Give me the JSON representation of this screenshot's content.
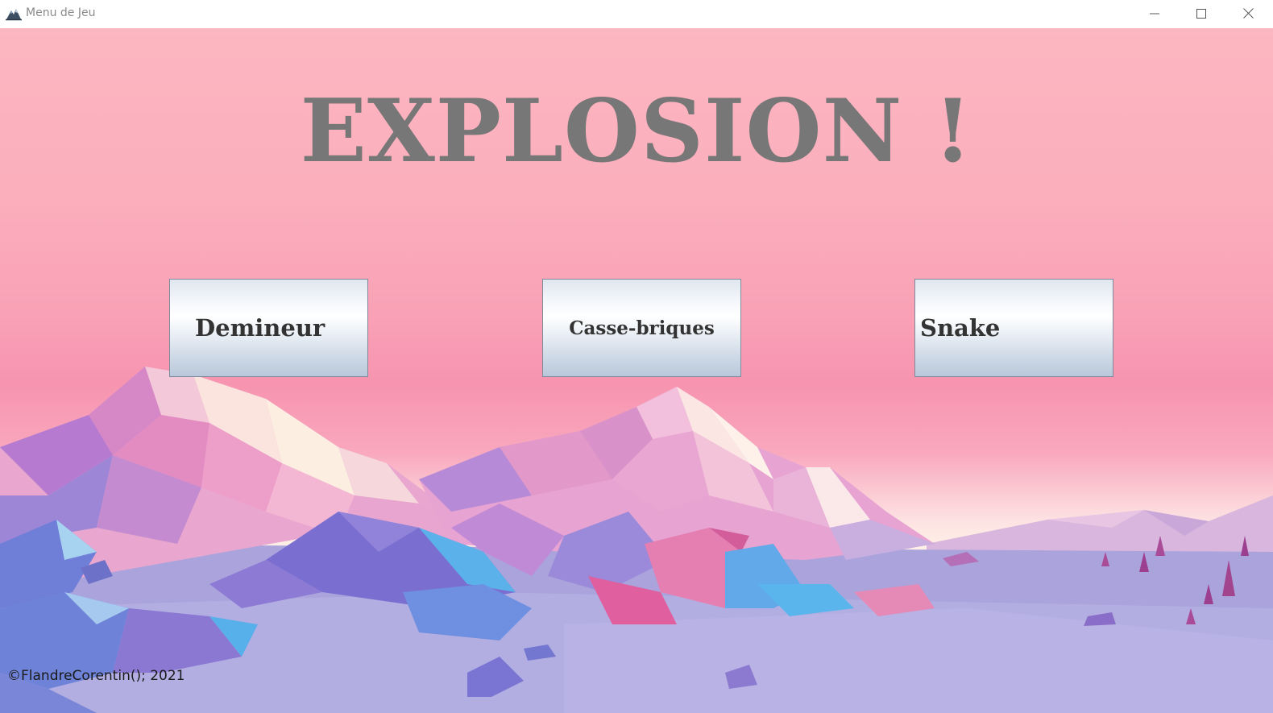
{
  "window": {
    "title": "Menu de Jeu",
    "controls": {
      "minimize_icon": "minimize-icon",
      "maximize_icon": "maximize-icon",
      "close_icon": "close-icon"
    }
  },
  "main": {
    "title": "EXPLOSION !",
    "buttons": [
      {
        "label": "Demineur"
      },
      {
        "label": "Casse-briques"
      },
      {
        "label": "Snake"
      }
    ],
    "copyright": "©FlandreCorentin(); 2021"
  },
  "colors": {
    "sky_top": "#fcb7c1",
    "sky_mid": "#f794b0",
    "title_text": "#777777",
    "button_text": "#333333",
    "ground": "#a8a2dc"
  }
}
